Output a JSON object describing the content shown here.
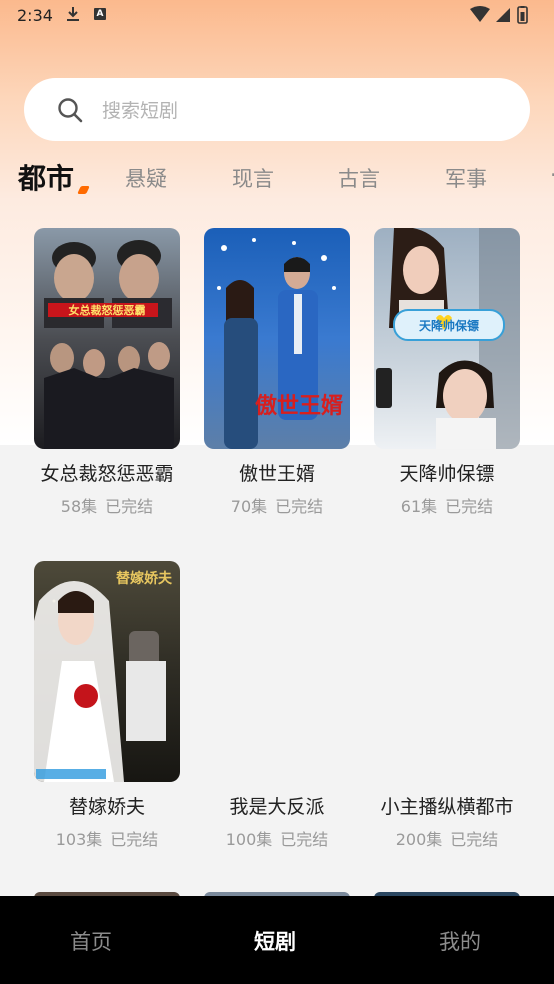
{
  "status_bar": {
    "time": "2:34",
    "notification_letter": "A"
  },
  "search": {
    "placeholder": "搜索短剧"
  },
  "tabs": [
    {
      "label": "都市",
      "active": true
    },
    {
      "label": "悬疑"
    },
    {
      "label": "现言"
    },
    {
      "label": "古言"
    },
    {
      "label": "军事"
    }
  ],
  "dramas": [
    {
      "title": "女总裁怒惩恶霸",
      "episodes": "58集",
      "status": "已完结",
      "cover_caption": "女总裁怒惩恶霸"
    },
    {
      "title": "傲世王婿",
      "episodes": "70集",
      "status": "已完结",
      "cover_caption": "傲世王婿"
    },
    {
      "title": "天降帅保镖",
      "episodes": "61集",
      "status": "已完结",
      "cover_caption": "天降帅保镖"
    },
    {
      "title": "替嫁娇夫",
      "episodes": "103集",
      "status": "已完结",
      "cover_caption": "替嫁娇夫"
    },
    {
      "title": "我是大反派",
      "episodes": "100集",
      "status": "已完结"
    },
    {
      "title": "小主播纵横都市",
      "episodes": "200集",
      "status": "已完结"
    }
  ],
  "bottom_nav": [
    {
      "label": "首页"
    },
    {
      "label": "短剧",
      "active": true
    },
    {
      "label": "我的"
    }
  ],
  "colors": {
    "accent": "#ff6a00",
    "nav_bg": "#000000",
    "active_nav": "#ffffff"
  }
}
